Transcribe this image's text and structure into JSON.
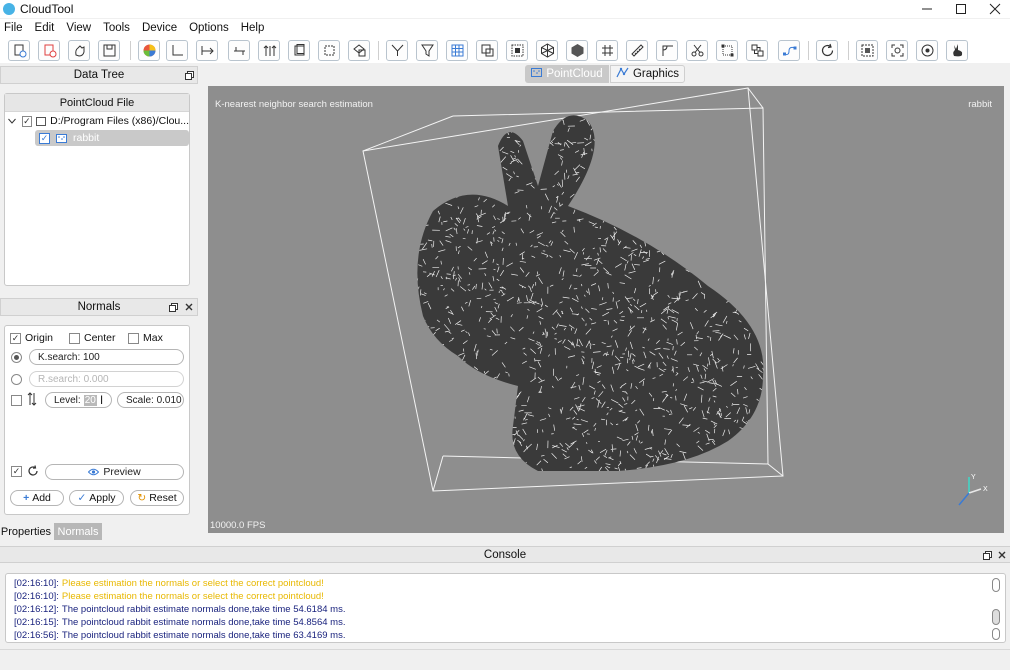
{
  "app": {
    "title": "CloudTool"
  },
  "menu": [
    "File",
    "Edit",
    "View",
    "Tools",
    "Device",
    "Options",
    "Help"
  ],
  "toolbar": {
    "buttons": [
      {
        "icon": "new-file-icon"
      },
      {
        "icon": "close-file-icon"
      },
      {
        "icon": "hand-icon"
      },
      {
        "icon": "save-icon"
      },
      {
        "icon": "color-wheel-icon"
      },
      {
        "icon": "axes-icon"
      },
      {
        "icon": "transform-icon"
      },
      {
        "icon": "split-icon"
      },
      {
        "icon": "arrows-up-icon"
      },
      {
        "icon": "layers-icon"
      },
      {
        "icon": "bounding-box-icon"
      },
      {
        "icon": "copy-shape-icon"
      },
      {
        "icon": "filter-y-icon"
      },
      {
        "icon": "funnel-icon"
      },
      {
        "icon": "grid-filter-icon"
      },
      {
        "icon": "overlay-icon"
      },
      {
        "icon": "select-box-icon"
      },
      {
        "icon": "mesh-icon"
      },
      {
        "icon": "solid-mesh-icon"
      },
      {
        "icon": "hash-grid-icon"
      },
      {
        "icon": "ruler-icon"
      },
      {
        "icon": "angle-icon"
      },
      {
        "icon": "scissors-icon"
      },
      {
        "icon": "crop-icon"
      },
      {
        "icon": "group-icon"
      },
      {
        "icon": "path-icon"
      },
      {
        "icon": "refresh-icon"
      },
      {
        "icon": "zoom-fit-icon"
      },
      {
        "icon": "focus-icon"
      },
      {
        "icon": "rotate-view-icon"
      },
      {
        "icon": "bunny-icon"
      }
    ]
  },
  "data_tree": {
    "title": "Data Tree",
    "header": "PointCloud File",
    "items": [
      {
        "label": "D:/Program Files (x86)/Clou...",
        "checked": true
      },
      {
        "label": "rabbit",
        "checked": true
      }
    ]
  },
  "normals": {
    "title": "Normals",
    "origin_label": "Origin",
    "center_label": "Center",
    "max_label": "Max",
    "ksearch_value": "K.search: 100",
    "rsearch_value": "R.search: 0.000",
    "level_label": "Level:",
    "level_value": "20",
    "scale_value": "Scale: 0.010",
    "preview_label": "Preview",
    "add_label": "Add",
    "apply_label": "Apply",
    "reset_label": "Reset"
  },
  "bottom_tabs": [
    "Properties",
    "Normals"
  ],
  "viewport": {
    "tabs": [
      "PointCloud",
      "Graphics"
    ],
    "title": "K-nearest neighbor search estimation",
    "cloud_name": "rabbit",
    "fps": "10000.0 FPS",
    "axis_labels": {
      "y": "Y",
      "x": "X"
    }
  },
  "console": {
    "title": "Console",
    "lines": [
      {
        "time": "[02:16:10]:",
        "text": "Please estimation the normals or select the correct pointcloud!",
        "color": "#e8b800"
      },
      {
        "time": "[02:16:10]:",
        "text": "Please estimation the normals or select the correct pointcloud!",
        "color": "#e8b800"
      },
      {
        "time": "[02:16:12]:",
        "text": "The pointcloud rabbit estimate normals done,take time 54.6184 ms.",
        "color": "#1a237e"
      },
      {
        "time": "[02:16:15]:",
        "text": "The pointcloud rabbit estimate normals done,take time 54.8564 ms.",
        "color": "#1a237e"
      },
      {
        "time": "[02:16:56]:",
        "text": "The pointcloud rabbit estimate normals done,take time 63.4169 ms.",
        "color": "#1a237e"
      }
    ]
  },
  "colors": {
    "accent": "#3a7bd5",
    "viewport_bg": "#8e8e8e",
    "warning": "#e8b800",
    "info": "#1a237e"
  }
}
